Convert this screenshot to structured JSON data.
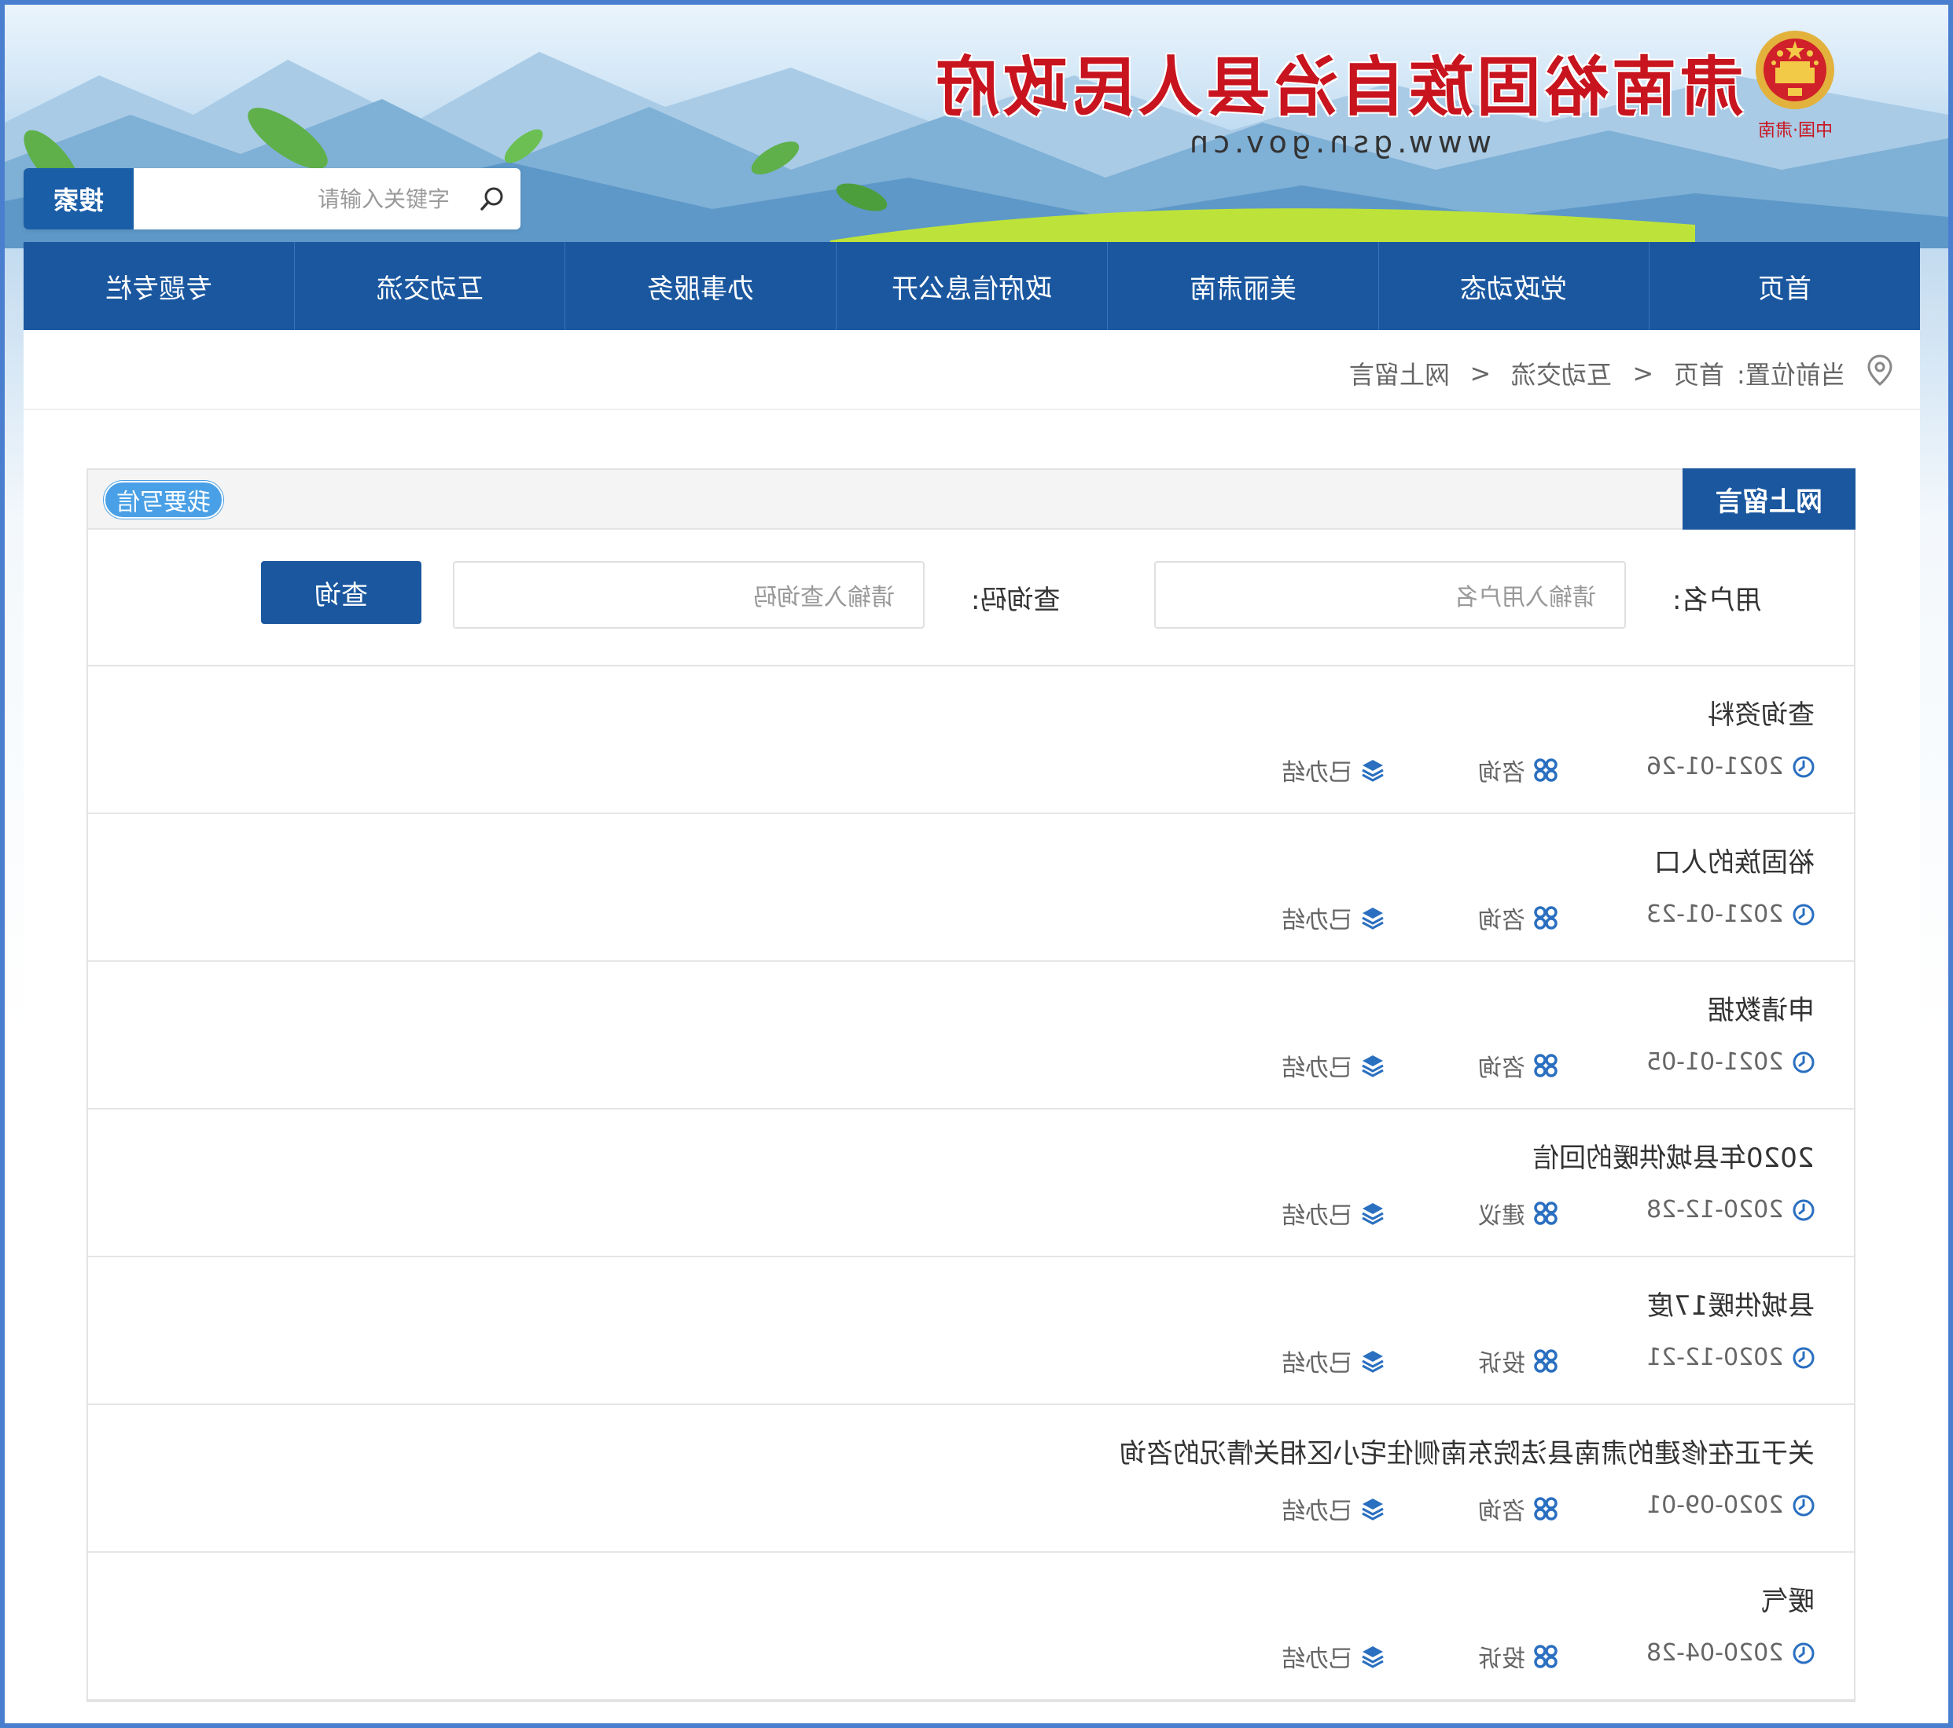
{
  "header": {
    "site_title": "肃南裕固族自治县人民政府",
    "site_url": "www.gsn.gov.cn",
    "emblem_caption": "中国·肃南",
    "search_button": "搜索",
    "search_placeholder": "请输入关键字"
  },
  "nav": {
    "items": [
      "首页",
      "党政动态",
      "美丽肃南",
      "政府信息公开",
      "办事服务",
      "互动交流",
      "专题专栏"
    ]
  },
  "breadcrumb": {
    "label": "当前位置:",
    "items": [
      "首页",
      "互动交流",
      "网上留言"
    ],
    "separator": ">"
  },
  "panel": {
    "tab_label": "网上留言",
    "write_button": "我要写信",
    "username_label": "用户名:",
    "username_placeholder": "请输入用户名",
    "code_label": "查询码:",
    "code_placeholder": "请输入查询码",
    "query_button": "查询"
  },
  "messages": [
    {
      "title": "查询资料",
      "date": "2021-01-26",
      "type": "咨询",
      "status": "已办结"
    },
    {
      "title": "裕固族的人口",
      "date": "2021-01-23",
      "type": "咨询",
      "status": "已办结"
    },
    {
      "title": "申请数据",
      "date": "2021-01-05",
      "type": "咨询",
      "status": "已办结"
    },
    {
      "title": "2020年县城供暖的回信",
      "date": "2020-12-28",
      "type": "建议",
      "status": "已办结"
    },
    {
      "title": "县城供暖17度",
      "date": "2020-12-21",
      "type": "投诉",
      "status": "已办结"
    },
    {
      "title": "关于正在修建的肃南县法院东南侧住宅小区相关情况的咨询",
      "date": "2020-09-01",
      "type": "咨询",
      "status": "已办结"
    },
    {
      "title": "暖气",
      "date": "2020-04-28",
      "type": "投诉",
      "status": "已办结"
    }
  ],
  "colors": {
    "primary": "#1a579f",
    "accent": "#4aa0e6",
    "title_red": "#c8141e"
  }
}
